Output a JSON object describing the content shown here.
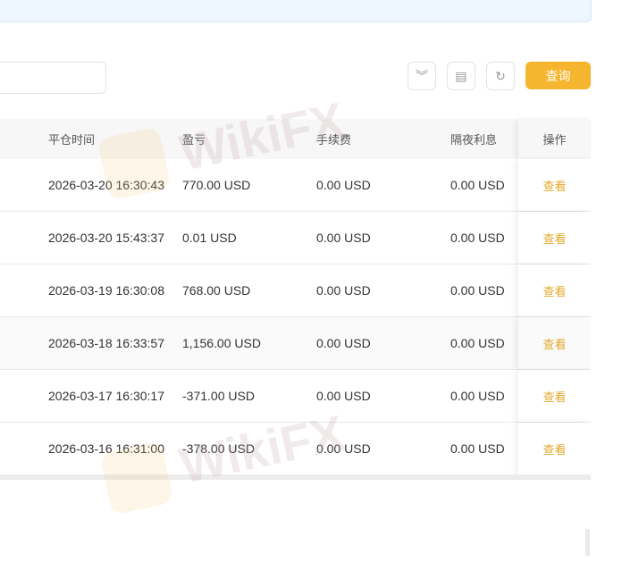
{
  "toolbar": {
    "query_label": "查询",
    "icons": [
      "double-chevron-down-icon",
      "excel-export-icon",
      "refresh-icon"
    ]
  },
  "table": {
    "headers": {
      "close_time": "平仓时间",
      "pnl": "盈亏",
      "fee": "手续费",
      "swap": "隔夜利息",
      "action": "操作"
    },
    "rows": [
      {
        "close_time": "2026-03-20 16:30:43",
        "pnl": "770.00 USD",
        "fee": "0.00 USD",
        "swap": "0.00 USD",
        "action": "查看"
      },
      {
        "close_time": "2026-03-20 15:43:37",
        "pnl": "0.01 USD",
        "fee": "0.00 USD",
        "swap": "0.00 USD",
        "action": "查看"
      },
      {
        "close_time": "2026-03-19 16:30:08",
        "pnl": "768.00 USD",
        "fee": "0.00 USD",
        "swap": "0.00 USD",
        "action": "查看"
      },
      {
        "close_time": "2026-03-18 16:33:57",
        "pnl": "1,156.00 USD",
        "fee": "0.00 USD",
        "swap": "0.00 USD",
        "action": "查看"
      },
      {
        "close_time": "2026-03-17 16:30:17",
        "pnl": "-371.00 USD",
        "fee": "0.00 USD",
        "swap": "0.00 USD",
        "action": "查看"
      },
      {
        "close_time": "2026-03-16 16:31:00",
        "pnl": "-378.00 USD",
        "fee": "0.00 USD",
        "swap": "0.00 USD",
        "action": "查看"
      }
    ]
  },
  "watermark": "WikiFX"
}
